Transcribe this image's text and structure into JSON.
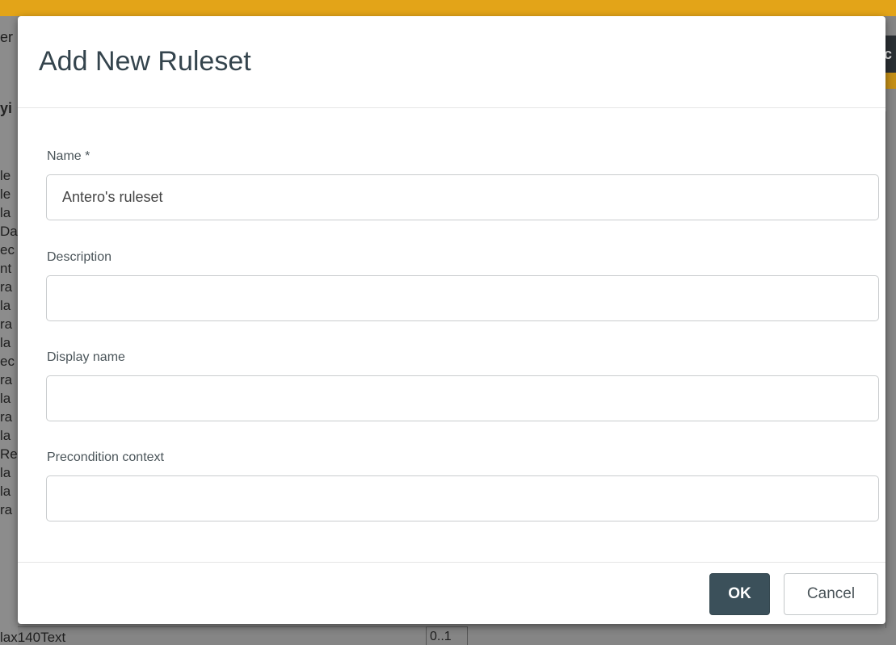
{
  "background": {
    "header_fragment_a": "er",
    "header_fragment_b": "yi",
    "right_button_fragment": "c",
    "row_fragments": [
      "le",
      "le",
      "la",
      "Da",
      "ec",
      "nt",
      "ra",
      "la",
      "ra",
      "la",
      "ec",
      "ra",
      "la",
      "ra",
      "la",
      "Re",
      "la",
      "la",
      "ra"
    ],
    "bottom_text": "lax140Text",
    "bottom_cell": "0..1"
  },
  "dialog": {
    "title": "Add New Ruleset",
    "fields": [
      {
        "label": "Name *",
        "value": "Antero's ruleset",
        "placeholder": ""
      },
      {
        "label": "Description",
        "value": "",
        "placeholder": ""
      },
      {
        "label": "Display name",
        "value": "",
        "placeholder": ""
      },
      {
        "label": "Precondition context",
        "value": "",
        "placeholder": ""
      }
    ],
    "ok_label": "OK",
    "cancel_label": "Cancel"
  },
  "colors": {
    "top_bar": "#e3a418",
    "title_text": "#34444d",
    "ok_button": "#3b505a"
  }
}
